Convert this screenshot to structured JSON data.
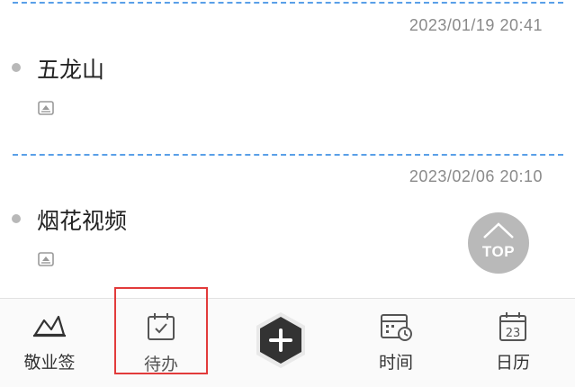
{
  "notes": [
    {
      "timestamp": "2023/01/19 20:41",
      "title": "五龙山"
    },
    {
      "timestamp": "2023/02/06 20:10",
      "title": "烟花视频"
    }
  ],
  "scroll_top": {
    "label": "TOP"
  },
  "tabbar": {
    "tabs": [
      {
        "label": "敬业签",
        "icon": "notes-logo-icon"
      },
      {
        "label": "待办",
        "icon": "calendar-check-icon"
      },
      {
        "label": "时间",
        "icon": "calendar-clock-icon"
      },
      {
        "label": "日历",
        "icon": "calendar-date-icon",
        "icon_text": "23"
      }
    ],
    "add_icon": "plus-icon"
  },
  "colors": {
    "divider": "#5aa0e8",
    "highlight": "#e23b3b",
    "add_button": "#333333",
    "top_button": "#b9b9b9"
  }
}
